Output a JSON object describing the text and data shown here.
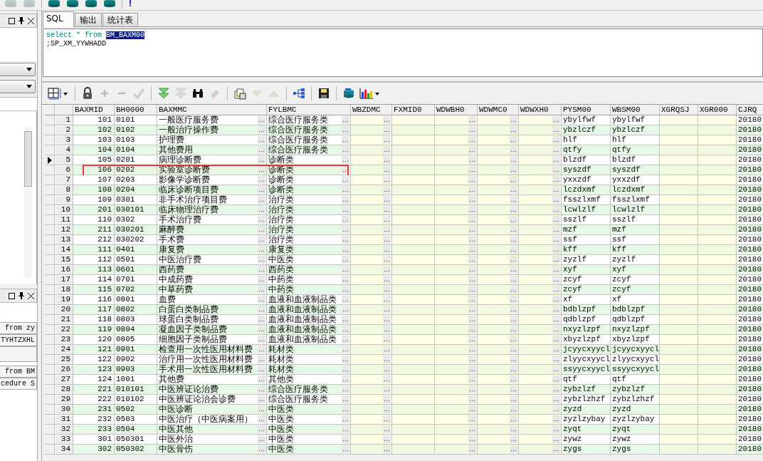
{
  "top_toolbar": [
    {
      "kind": "database",
      "disabled": true
    },
    {
      "kind": "database",
      "disabled": true
    },
    {
      "kind": "separator"
    },
    {
      "kind": "database",
      "disabled": false
    },
    {
      "kind": "database",
      "disabled": false
    },
    {
      "kind": "database",
      "disabled": false
    },
    {
      "kind": "database",
      "disabled": false
    },
    {
      "kind": "separator"
    },
    {
      "kind": "info",
      "disabled": false
    }
  ],
  "left_panel": {
    "upper_items": [
      "from zy",
      "TYHTZXHL"
    ],
    "lower_items": [
      "from BM",
      "cedure S"
    ]
  },
  "tabs": [
    {
      "label": "SQL",
      "selected": true
    },
    {
      "label": "输出",
      "selected": false
    },
    {
      "label": "统计表",
      "selected": false
    }
  ],
  "sql_editor": {
    "lines": [
      [
        {
          "text": "select * from ",
          "kind": "keyword"
        },
        {
          "text": "BM_BAXM00",
          "kind": "selected"
        }
      ],
      [
        {
          "text": ";",
          "kind": "symbol"
        },
        {
          "text": "SP_XM_YYWHADD",
          "kind": "plain"
        }
      ]
    ]
  },
  "grid_toolbar": [
    {
      "kind": "grid",
      "disabled": false
    },
    {
      "kind": "separator"
    },
    {
      "kind": "lock",
      "disabled": false
    },
    {
      "kind": "plus",
      "disabled": true
    },
    {
      "kind": "minus",
      "disabled": true
    },
    {
      "kind": "check",
      "disabled": true
    },
    {
      "kind": "separator"
    },
    {
      "kind": "down",
      "disabled": false
    },
    {
      "kind": "down",
      "disabled": true
    },
    {
      "kind": "binoculars",
      "disabled": false
    },
    {
      "kind": "eraser",
      "disabled": true
    },
    {
      "kind": "separator"
    },
    {
      "kind": "documents",
      "disabled": false
    },
    {
      "kind": "triangle-down",
      "disabled": true
    },
    {
      "kind": "triangle-up",
      "disabled": true
    },
    {
      "kind": "separator"
    },
    {
      "kind": "tree",
      "disabled": false
    },
    {
      "kind": "separator"
    },
    {
      "kind": "save",
      "disabled": false
    },
    {
      "kind": "separator"
    },
    {
      "kind": "database",
      "disabled": false
    },
    {
      "kind": "chart",
      "disabled": false
    }
  ],
  "grid": {
    "cell_button_label": "…",
    "columns": [
      {
        "label": "BAXMID",
        "kind": "number"
      },
      {
        "label": "BH0000",
        "kind": "text"
      },
      {
        "label": "BAXMMC",
        "kind": "lookup"
      },
      {
        "label": "FYLBMC",
        "kind": "lookup"
      },
      {
        "label": "WBZDMC",
        "kind": "lookup"
      },
      {
        "label": "FXMID0",
        "kind": "text"
      },
      {
        "label": "WDWBH0",
        "kind": "lookup"
      },
      {
        "label": "WDWMC0",
        "kind": "lookup"
      },
      {
        "label": "WDWXH0",
        "kind": "lookup"
      },
      {
        "label": "PYSM00",
        "kind": "text"
      },
      {
        "label": "WBSM00",
        "kind": "text"
      },
      {
        "label": "XGRQSJ",
        "kind": "text"
      },
      {
        "label": "XGR000",
        "kind": "text"
      },
      {
        "label": "CJRQ",
        "kind": "text"
      }
    ],
    "rows": [
      {
        "number": "1",
        "baxmid": "101",
        "bh0000": "0101",
        "baxmmc": "一般医疗服务费",
        "fylbmc": "综合医疗服务类",
        "pysm00": "ybylfwf",
        "wbsm00": "ybylfwf",
        "cjrq": "20180",
        "current": false,
        "highlighted": false
      },
      {
        "number": "2",
        "baxmid": "102",
        "bh0000": "0102",
        "baxmmc": "一般治疗操作费",
        "fylbmc": "综合医疗服务类",
        "pysm00": "ybzlczf",
        "wbsm00": "ybzlczf",
        "cjrq": "20180",
        "current": false,
        "highlighted": false
      },
      {
        "number": "3",
        "baxmid": "103",
        "bh0000": "0103",
        "baxmmc": "护理费",
        "fylbmc": "综合医疗服务类",
        "pysm00": "hlf",
        "wbsm00": "hlf",
        "cjrq": "20180",
        "current": false,
        "highlighted": false
      },
      {
        "number": "4",
        "baxmid": "104",
        "bh0000": "0104",
        "baxmmc": "其他费用",
        "fylbmc": "综合医疗服务类",
        "pysm00": "qtfy",
        "wbsm00": "qtfy",
        "cjrq": "20180",
        "current": false,
        "highlighted": false
      },
      {
        "number": "5",
        "baxmid": "105",
        "bh0000": "0201",
        "baxmmc": "病理诊断费",
        "fylbmc": "诊断类",
        "pysm00": "blzdf",
        "wbsm00": "blzdf",
        "cjrq": "20180",
        "current": true,
        "highlighted": false
      },
      {
        "number": "6",
        "baxmid": "106",
        "bh0000": "0202",
        "baxmmc": "实验室诊断费",
        "fylbmc": "诊断类",
        "pysm00": "syszdf",
        "wbsm00": "syszdf",
        "cjrq": "20180",
        "current": false,
        "highlighted": true
      },
      {
        "number": "7",
        "baxmid": "107",
        "bh0000": "0203",
        "baxmmc": "影像学诊断费",
        "fylbmc": "诊断类",
        "pysm00": "yxxzdf",
        "wbsm00": "yxxzdf",
        "cjrq": "20180",
        "current": false,
        "highlighted": false
      },
      {
        "number": "8",
        "baxmid": "108",
        "bh0000": "0204",
        "baxmmc": "临床诊断项目费",
        "fylbmc": "诊断类",
        "pysm00": "lczdxmf",
        "wbsm00": "lczdxmf",
        "cjrq": "20180",
        "current": false,
        "highlighted": false
      },
      {
        "number": "9",
        "baxmid": "109",
        "bh0000": "0301",
        "baxmmc": "非手术治疗项目费",
        "fylbmc": "治疗类",
        "pysm00": "fsszlxmf",
        "wbsm00": "fsszlxmf",
        "cjrq": "20180",
        "current": false,
        "highlighted": false
      },
      {
        "number": "10",
        "baxmid": "201",
        "bh0000": "030101",
        "baxmmc": "临床物理治疗费",
        "fylbmc": "治疗类",
        "pysm00": "lcwlzlf",
        "wbsm00": "lcwlzlf",
        "cjrq": "20180",
        "current": false,
        "highlighted": false
      },
      {
        "number": "11",
        "baxmid": "110",
        "bh0000": "0302",
        "baxmmc": "手术治疗费",
        "fylbmc": "治疗类",
        "pysm00": "sszlf",
        "wbsm00": "sszlf",
        "cjrq": "20180",
        "current": false,
        "highlighted": false
      },
      {
        "number": "12",
        "baxmid": "211",
        "bh0000": "030201",
        "baxmmc": "麻醉费",
        "fylbmc": "治疗类",
        "pysm00": "mzf",
        "wbsm00": "mzf",
        "cjrq": "20180",
        "current": false,
        "highlighted": false
      },
      {
        "number": "13",
        "baxmid": "212",
        "bh0000": "030202",
        "baxmmc": "手术费",
        "fylbmc": "治疗类",
        "pysm00": "ssf",
        "wbsm00": "ssf",
        "cjrq": "20180",
        "current": false,
        "highlighted": false
      },
      {
        "number": "14",
        "baxmid": "111",
        "bh0000": "0401",
        "baxmmc": "康复费",
        "fylbmc": "康复类",
        "pysm00": "kff",
        "wbsm00": "kff",
        "cjrq": "20180",
        "current": false,
        "highlighted": false
      },
      {
        "number": "15",
        "baxmid": "112",
        "bh0000": "0501",
        "baxmmc": "中医治疗费",
        "fylbmc": "中医类",
        "pysm00": "zyzlf",
        "wbsm00": "zyzlf",
        "cjrq": "20180",
        "current": false,
        "highlighted": false
      },
      {
        "number": "16",
        "baxmid": "113",
        "bh0000": "0601",
        "baxmmc": "西药费",
        "fylbmc": "西药类",
        "pysm00": "xyf",
        "wbsm00": "xyf",
        "cjrq": "20180",
        "current": false,
        "highlighted": false
      },
      {
        "number": "17",
        "baxmid": "114",
        "bh0000": "0701",
        "baxmmc": "中成药费",
        "fylbmc": "中药类",
        "pysm00": "zcyf",
        "wbsm00": "zcyf",
        "cjrq": "20180",
        "current": false,
        "highlighted": false
      },
      {
        "number": "18",
        "baxmid": "115",
        "bh0000": "0702",
        "baxmmc": "中草药费",
        "fylbmc": "中药类",
        "pysm00": "zcyf",
        "wbsm00": "zcyf",
        "cjrq": "20180",
        "current": false,
        "highlighted": false
      },
      {
        "number": "19",
        "baxmid": "116",
        "bh0000": "0801",
        "baxmmc": "血费",
        "fylbmc": "血液和血液制品类",
        "pysm00": "xf",
        "wbsm00": "xf",
        "cjrq": "20180",
        "current": false,
        "highlighted": false
      },
      {
        "number": "20",
        "baxmid": "117",
        "bh0000": "0802",
        "baxmmc": "白蛋白类制品费",
        "fylbmc": "血液和血液制品类",
        "pysm00": "bdblzpf",
        "wbsm00": "bdblzpf",
        "cjrq": "20180",
        "current": false,
        "highlighted": false
      },
      {
        "number": "21",
        "baxmid": "118",
        "bh0000": "0803",
        "baxmmc": "球蛋白类制品费",
        "fylbmc": "血液和血液制品类",
        "pysm00": "qdblzpf",
        "wbsm00": "qdblzpf",
        "cjrq": "20180",
        "current": false,
        "highlighted": false
      },
      {
        "number": "22",
        "baxmid": "119",
        "bh0000": "0804",
        "baxmmc": "凝血因子类制品费",
        "fylbmc": "血液和血液制品类",
        "pysm00": "nxyzlzpf",
        "wbsm00": "nxyzlzpf",
        "cjrq": "20180",
        "current": false,
        "highlighted": false
      },
      {
        "number": "23",
        "baxmid": "120",
        "bh0000": "0805",
        "baxmmc": "细胞因子类制品费",
        "fylbmc": "血液和血液制品类",
        "pysm00": "xbyzlzpf",
        "wbsm00": "xbyzlzpf",
        "cjrq": "20180",
        "current": false,
        "highlighted": false
      },
      {
        "number": "24",
        "baxmid": "121",
        "bh0000": "0901",
        "baxmmc": "检查用一次性医用材料费",
        "fylbmc": "耗材类",
        "pysm00": "jcyycxyycl",
        "wbsm00": "jcyycxyycl",
        "cjrq": "20180",
        "current": false,
        "highlighted": false
      },
      {
        "number": "25",
        "baxmid": "122",
        "bh0000": "0902",
        "baxmmc": "治疗用一次性医用材料费",
        "fylbmc": "耗材类",
        "pysm00": "zlyycxyycl",
        "wbsm00": "zlyycxyycl",
        "cjrq": "20180",
        "current": false,
        "highlighted": false
      },
      {
        "number": "26",
        "baxmid": "123",
        "bh0000": "0903",
        "baxmmc": "手术用一次性医用材料费",
        "fylbmc": "耗材类",
        "pysm00": "ssyycxyycl",
        "wbsm00": "ssyycxyycl",
        "cjrq": "20180",
        "current": false,
        "highlighted": false
      },
      {
        "number": "27",
        "baxmid": "124",
        "bh0000": "1001",
        "baxmmc": "其他费",
        "fylbmc": "其他类",
        "pysm00": "qtf",
        "wbsm00": "qtf",
        "cjrq": "20180",
        "current": false,
        "highlighted": false
      },
      {
        "number": "28",
        "baxmid": "221",
        "bh0000": "010101",
        "baxmmc": "中医辨证论治费",
        "fylbmc": "综合医疗服务类",
        "pysm00": "zybzlzf",
        "wbsm00": "zybzlzf",
        "cjrq": "20180",
        "current": false,
        "highlighted": false
      },
      {
        "number": "29",
        "baxmid": "222",
        "bh0000": "010102",
        "baxmmc": "中医辨证论治会诊费",
        "fylbmc": "综合医疗服务类",
        "pysm00": "zybzlzhzf",
        "wbsm00": "zybzlzhzf",
        "cjrq": "20180",
        "current": false,
        "highlighted": false
      },
      {
        "number": "30",
        "baxmid": "231",
        "bh0000": "0502",
        "baxmmc": "中医诊断",
        "fylbmc": "中医类",
        "pysm00": "zyzd",
        "wbsm00": "zyzd",
        "cjrq": "20180",
        "current": false,
        "highlighted": false
      },
      {
        "number": "31",
        "baxmid": "232",
        "bh0000": "0503",
        "baxmmc": "中医治疗（中医病案用）",
        "fylbmc": "中医类",
        "pysm00": "zyzlzybay",
        "wbsm00": "zyzlzybay",
        "cjrq": "20180",
        "current": false,
        "highlighted": false
      },
      {
        "number": "32",
        "baxmid": "233",
        "bh0000": "0504",
        "baxmmc": "中医其他",
        "fylbmc": "中医类",
        "pysm00": "zyqt",
        "wbsm00": "zyqt",
        "cjrq": "20180",
        "current": false,
        "highlighted": false
      },
      {
        "number": "33",
        "baxmid": "301",
        "bh0000": "050301",
        "baxmmc": "中医外治",
        "fylbmc": "中医类",
        "pysm00": "zywz",
        "wbsm00": "zywz",
        "cjrq": "20180",
        "current": false,
        "highlighted": false
      },
      {
        "number": "34",
        "baxmid": "302",
        "bh0000": "050302",
        "baxmmc": "中医骨伤",
        "fylbmc": "中医类",
        "pysm00": "zygs",
        "wbsm00": "zygs",
        "cjrq": "20180",
        "current": false,
        "highlighted": false
      }
    ]
  }
}
